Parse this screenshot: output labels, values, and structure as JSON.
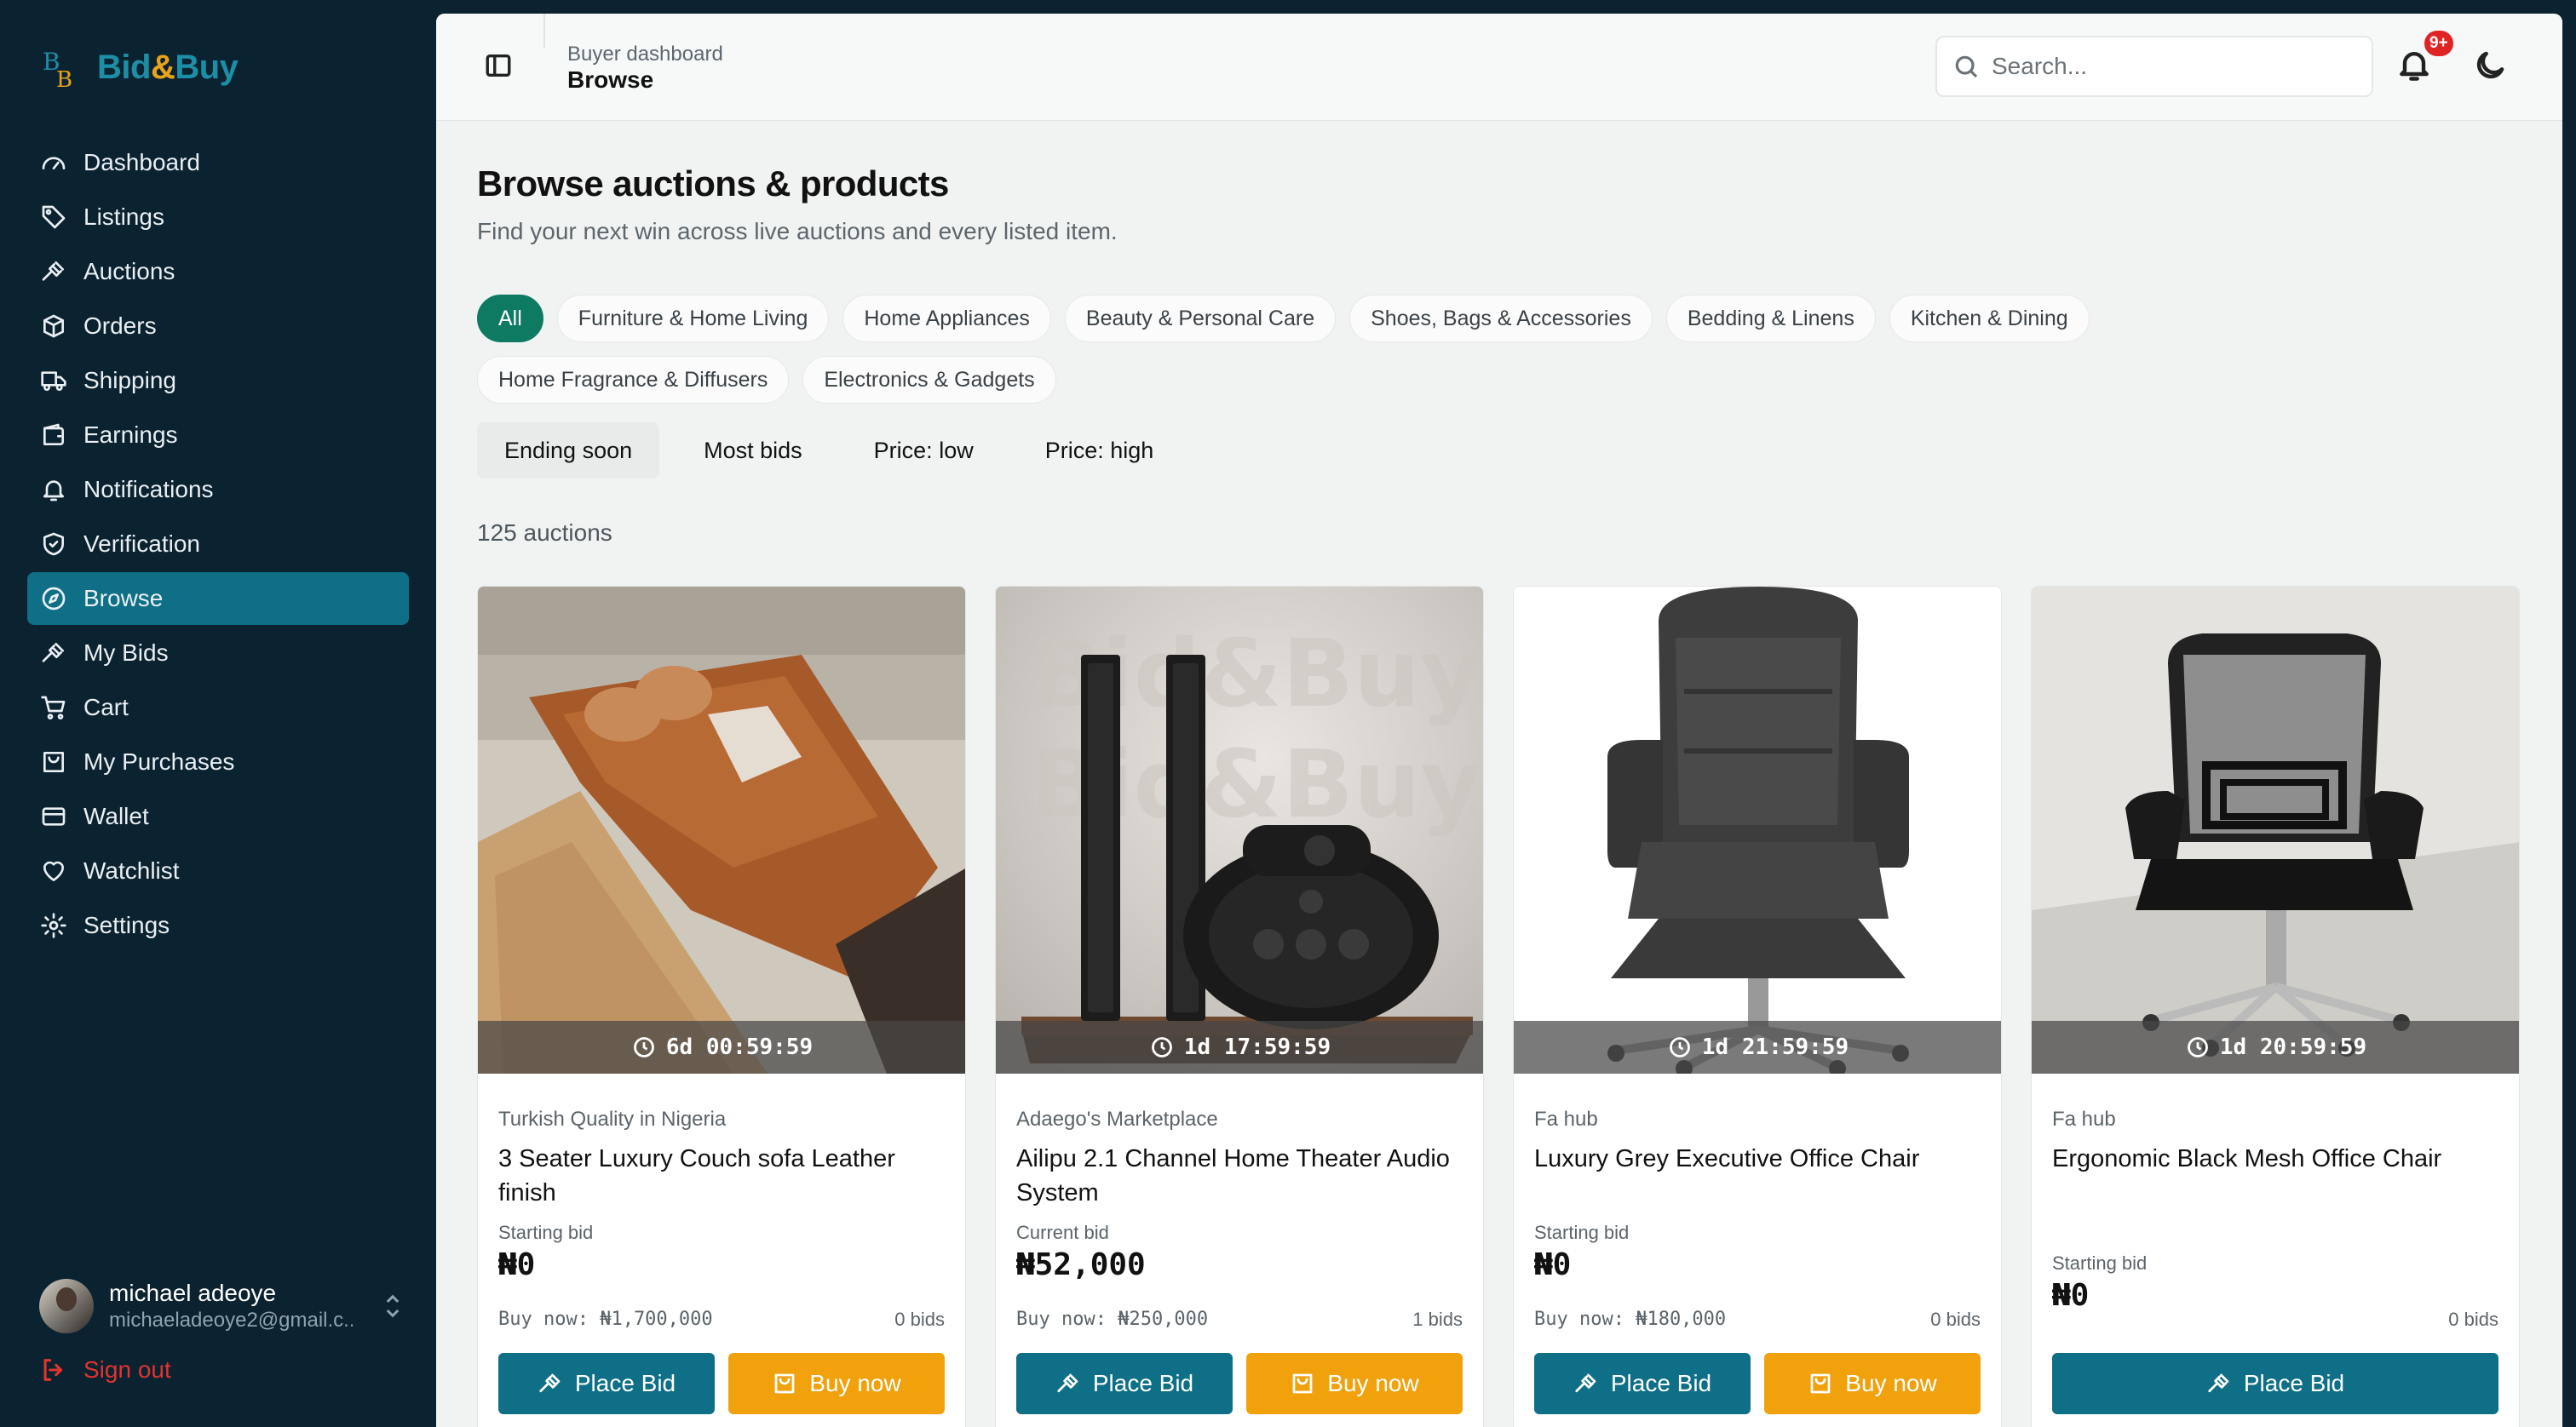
{
  "brand": {
    "name_part1": "Bid",
    "name_amp": "&",
    "name_part2": "Buy"
  },
  "sidebar": {
    "items": [
      {
        "label": "Dashboard",
        "icon": "dashboard-gauge-icon"
      },
      {
        "label": "Listings",
        "icon": "tag-icon"
      },
      {
        "label": "Auctions",
        "icon": "gavel-icon"
      },
      {
        "label": "Orders",
        "icon": "package-icon"
      },
      {
        "label": "Shipping",
        "icon": "truck-icon"
      },
      {
        "label": "Earnings",
        "icon": "wallet-icon"
      },
      {
        "label": "Notifications",
        "icon": "bell-icon"
      },
      {
        "label": "Verification",
        "icon": "shield-check-icon"
      },
      {
        "label": "Browse",
        "icon": "compass-icon",
        "active": true
      },
      {
        "label": "My Bids",
        "icon": "gavel-icon"
      },
      {
        "label": "Cart",
        "icon": "cart-icon"
      },
      {
        "label": "My Purchases",
        "icon": "shopping-bag-icon"
      },
      {
        "label": "Wallet",
        "icon": "credit-card-icon"
      },
      {
        "label": "Watchlist",
        "icon": "heart-icon"
      },
      {
        "label": "Settings",
        "icon": "gear-icon"
      }
    ],
    "profile": {
      "name": "michael adeoye",
      "email": "michaeladeoye2@gmail.c..."
    },
    "signout_label": "Sign out"
  },
  "header": {
    "breadcrumb_parent": "Buyer dashboard",
    "breadcrumb_current": "Browse",
    "search_placeholder": "Search...",
    "notification_badge": "9+"
  },
  "page": {
    "title": "Browse auctions & products",
    "subtitle": "Find your next win across live auctions and every listed item.",
    "categories": [
      "All",
      "Furniture & Home Living",
      "Home Appliances",
      "Beauty & Personal Care",
      "Shoes, Bags & Accessories",
      "Bedding & Linens",
      "Kitchen & Dining",
      "Home Fragrance & Diffusers",
      "Electronics & Gadgets"
    ],
    "active_category": "All",
    "sorts": [
      "Ending soon",
      "Most bids",
      "Price: low",
      "Price: high"
    ],
    "active_sort": "Ending soon",
    "count_label": "125 auctions"
  },
  "products": [
    {
      "timer": "6d 00:59:59",
      "seller": "Turkish Quality in Nigeria",
      "title": "3 Seater Luxury Couch sofa Leather finish",
      "bid_label": "Starting bid",
      "bid_value": "₦0",
      "buy_now": "Buy now: ₦1,700,000",
      "bids": "0 bids",
      "place_bid_label": "Place Bid",
      "buy_now_label": "Buy now"
    },
    {
      "timer": "1d 17:59:59",
      "seller": "Adaego's Marketplace",
      "title": "Ailipu 2.1 Channel Home Theater Audio System",
      "bid_label": "Current bid",
      "bid_value": "₦52,000",
      "buy_now": "Buy now: ₦250,000",
      "bids": "1 bids",
      "place_bid_label": "Place Bid",
      "buy_now_label": "Buy now"
    },
    {
      "timer": "1d 21:59:59",
      "seller": "Fa hub",
      "title": "Luxury Grey Executive Office Chair",
      "bid_label": "Starting bid",
      "bid_value": "₦0",
      "buy_now": "Buy now: ₦180,000",
      "bids": "0 bids",
      "place_bid_label": "Place Bid",
      "buy_now_label": "Buy now"
    },
    {
      "timer": "1d 20:59:59",
      "seller": "Fa hub",
      "title": "Ergonomic Black Mesh Office Chair",
      "bid_label": "Starting bid",
      "bid_value": "₦0",
      "bids": "0 bids",
      "place_bid_label": "Place Bid"
    }
  ],
  "colors": {
    "sidebar_bg": "#0b2230",
    "active_nav": "#0e6f86",
    "chip_active": "#0e7a62",
    "bid_button": "#0e6f86",
    "buy_button": "#f0a10c",
    "badge": "#e02424"
  }
}
